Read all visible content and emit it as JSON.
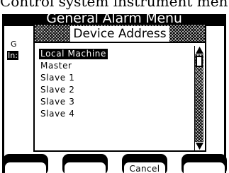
{
  "caption": "Control system instrument menu",
  "menu": {
    "title": "General Alarm Menu",
    "background_items": [
      {
        "text": "G",
        "selected": false
      },
      {
        "text": "In:",
        "selected": true
      }
    ]
  },
  "dialog": {
    "title": "Device Address",
    "items": [
      {
        "label": "Local Machine",
        "selected": true
      },
      {
        "label": "Master",
        "selected": false
      },
      {
        "label": "Slave 1",
        "selected": false
      },
      {
        "label": "Slave 2",
        "selected": false
      },
      {
        "label": "Slave 3",
        "selected": false
      },
      {
        "label": "Slave 4",
        "selected": false
      }
    ],
    "scrollbar": {
      "up_icon": "scroll-up-arrow-icon",
      "down_icon": "scroll-down-arrow-icon"
    }
  },
  "softkeys": [
    {
      "label": ""
    },
    {
      "label": ""
    },
    {
      "label": "Cancel"
    },
    {
      "label": ""
    }
  ],
  "colors": {
    "lcd_background": "#ffffff",
    "lcd_foreground": "#000000",
    "dither_gray": "#bdbdbd"
  }
}
